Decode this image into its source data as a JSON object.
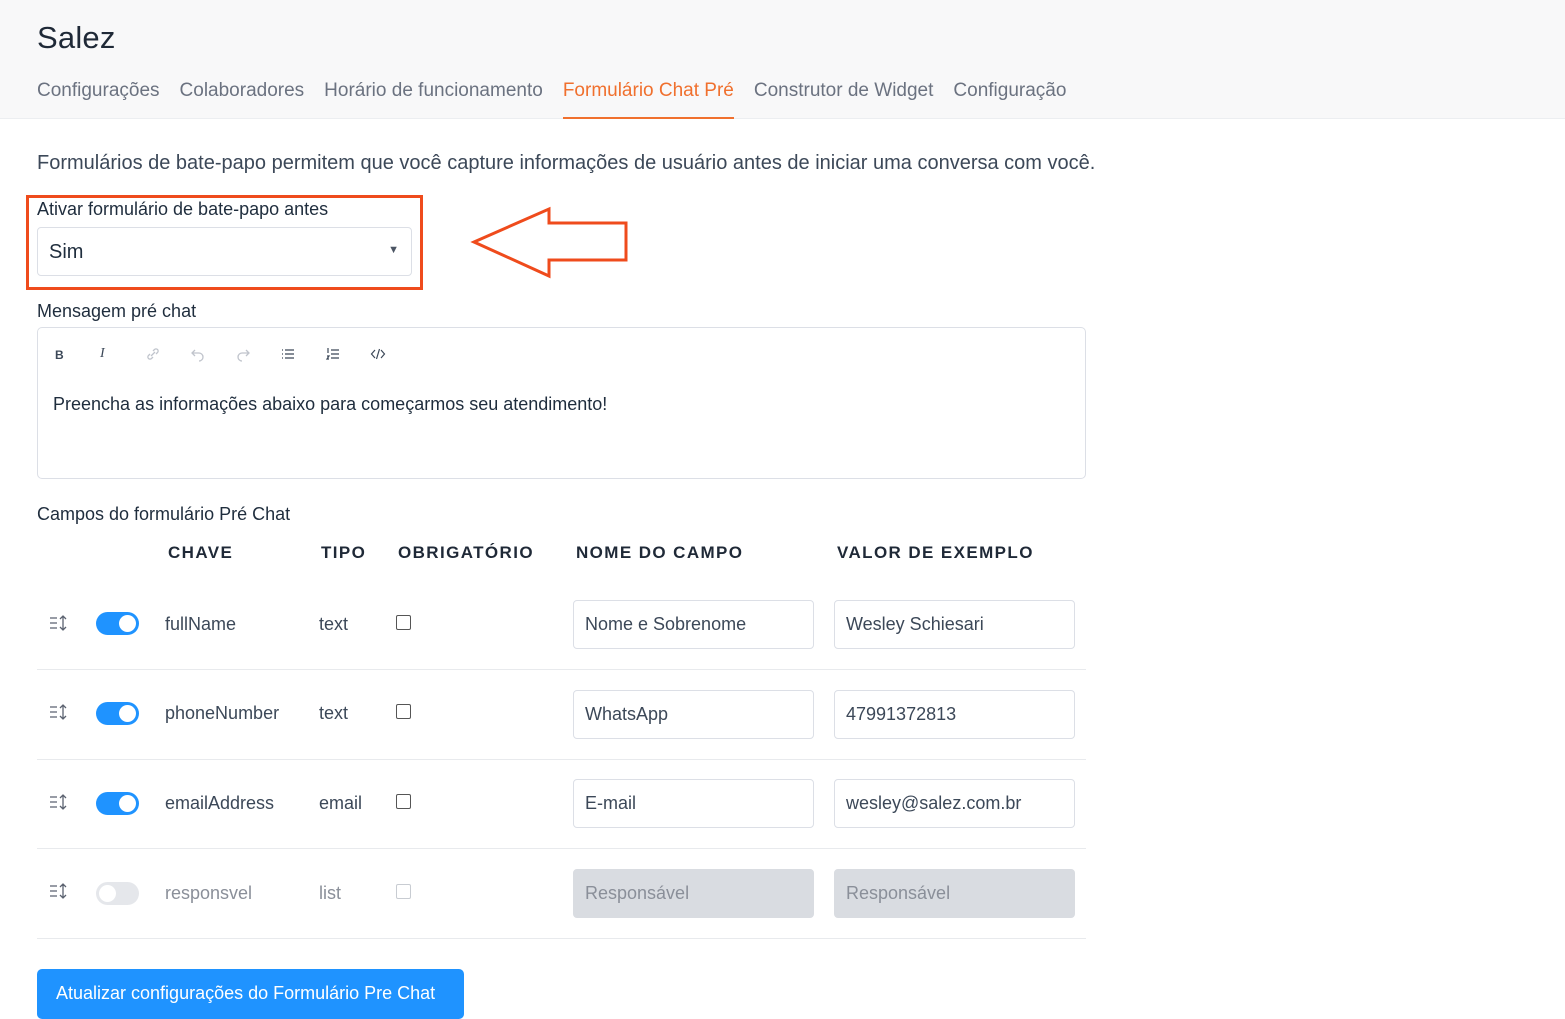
{
  "app_title": "Salez",
  "tabs": [
    {
      "label": "Configurações",
      "active": false
    },
    {
      "label": "Colaboradores",
      "active": false
    },
    {
      "label": "Horário de funcionamento",
      "active": false
    },
    {
      "label": "Formulário Chat Pré",
      "active": true
    },
    {
      "label": "Construtor de Widget",
      "active": false
    },
    {
      "label": "Configuração",
      "active": false
    }
  ],
  "intro_text": "Formulários de bate-papo permitem que você capture informações de usuário antes de iniciar uma conversa com você.",
  "enable_form": {
    "label": "Ativar formulário de bate-papo antes",
    "value": "Sim"
  },
  "message": {
    "label": "Mensagem pré chat",
    "toolbar": [
      "bold-icon",
      "italic-icon",
      "link-icon",
      "undo-icon",
      "redo-icon",
      "bullet-list-icon",
      "ordered-list-icon",
      "code-icon"
    ],
    "text": "Preencha as informações abaixo para começarmos seu atendimento!"
  },
  "fields": {
    "label": "Campos do formulário Pré Chat",
    "headers": {
      "key": "CHAVE",
      "type": "TIPO",
      "required": "OBRIGATÓRIO",
      "field_name": "NOME DO CAMPO",
      "example": "VALOR DE EXEMPLO"
    },
    "rows": [
      {
        "enabled": true,
        "key": "fullName",
        "type": "text",
        "required": false,
        "field_name": "Nome e Sobrenome",
        "example": "Wesley Schiesari"
      },
      {
        "enabled": true,
        "key": "phoneNumber",
        "type": "text",
        "required": false,
        "field_name": "WhatsApp",
        "example": "47991372813"
      },
      {
        "enabled": true,
        "key": "emailAddress",
        "type": "email",
        "required": false,
        "field_name": "E-mail",
        "example": "wesley@salez.com.br"
      },
      {
        "enabled": false,
        "key": "responsvel",
        "type": "list",
        "required": false,
        "field_name": "Responsável",
        "example": "Responsável"
      }
    ]
  },
  "submit_label": "Atualizar configurações do Formulário Pre Chat",
  "colors": {
    "accent": "#1f93ff",
    "active_tab": "#f0702e",
    "annotation": "#ef4b1c"
  }
}
